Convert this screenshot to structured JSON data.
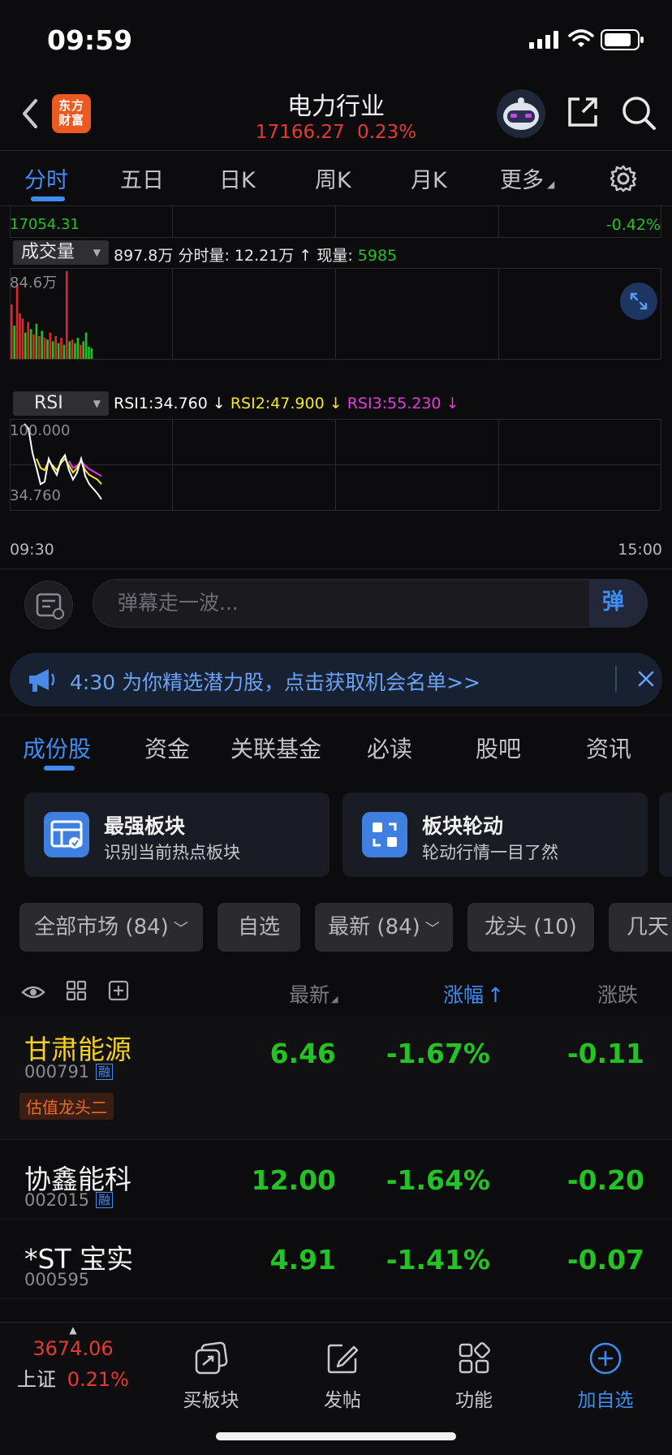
{
  "status": {
    "time": "09:59"
  },
  "header": {
    "logo_line1": "东方",
    "logo_line2": "财富",
    "title": "电力行业",
    "index_value": "17166.27",
    "index_change": "0.23%"
  },
  "chart_tabs": [
    "分时",
    "五日",
    "日K",
    "周K",
    "月K",
    "更多"
  ],
  "chart": {
    "price_low": "17054.31",
    "pct_low": "-0.42%",
    "volume": {
      "selector": "成交量",
      "total": "897.8万",
      "period_label": "分时量: 12.21万",
      "current_label": "现量:",
      "current_value": "5985",
      "max_label": "84.6万",
      "bars": [
        {
          "v": 0.62,
          "c": "red"
        },
        {
          "v": 0.38,
          "c": "green"
        },
        {
          "v": 0.85,
          "c": "red"
        },
        {
          "v": 0.52,
          "c": "red"
        },
        {
          "v": 0.46,
          "c": "red"
        },
        {
          "v": 0.3,
          "c": "green"
        },
        {
          "v": 0.42,
          "c": "red"
        },
        {
          "v": 0.34,
          "c": "green"
        },
        {
          "v": 0.28,
          "c": "red"
        },
        {
          "v": 0.4,
          "c": "green"
        },
        {
          "v": 0.26,
          "c": "red"
        },
        {
          "v": 0.32,
          "c": "green"
        },
        {
          "v": 0.24,
          "c": "red"
        },
        {
          "v": 0.22,
          "c": "green"
        },
        {
          "v": 0.3,
          "c": "red"
        },
        {
          "v": 0.2,
          "c": "green"
        },
        {
          "v": 0.26,
          "c": "red"
        },
        {
          "v": 0.18,
          "c": "green"
        },
        {
          "v": 0.24,
          "c": "red"
        },
        {
          "v": 0.16,
          "c": "green"
        },
        {
          "v": 1.0,
          "c": "red"
        },
        {
          "v": 0.2,
          "c": "green"
        },
        {
          "v": 0.22,
          "c": "red"
        },
        {
          "v": 0.18,
          "c": "green"
        },
        {
          "v": 0.24,
          "c": "green"
        },
        {
          "v": 0.16,
          "c": "red"
        },
        {
          "v": 0.2,
          "c": "green"
        },
        {
          "v": 0.3,
          "c": "green"
        },
        {
          "v": 0.14,
          "c": "green"
        },
        {
          "v": 0.12,
          "c": "green"
        }
      ]
    },
    "rsi": {
      "selector": "RSI",
      "rsi1_label": "RSI1:34.760 ↓",
      "rsi2_label": "RSI2:47.900 ↓",
      "rsi3_label": "RSI3:55.230 ↓",
      "top_label": "100.000",
      "bottom_label": "34.760",
      "rsi1_color": "#ffffff",
      "rsi2_color": "#f5e623",
      "rsi3_color": "#e43ae0",
      "rsi1": [
        100,
        96,
        75,
        62,
        48,
        50,
        70,
        62,
        56,
        68,
        73,
        60,
        52,
        58,
        70,
        55,
        48,
        44,
        40,
        35
      ],
      "rsi2": [
        null,
        null,
        null,
        70,
        62,
        60,
        68,
        64,
        60,
        66,
        70,
        64,
        58,
        62,
        68,
        60,
        56,
        54,
        52,
        48
      ],
      "rsi3": [
        null,
        null,
        null,
        null,
        null,
        null,
        null,
        null,
        null,
        null,
        null,
        68,
        62,
        64,
        68,
        64,
        61,
        59,
        57,
        55
      ]
    },
    "time_start": "09:30",
    "time_end": "15:00"
  },
  "danmaku": {
    "placeholder": "弹幕走一波...",
    "send_label": "弹"
  },
  "banner": {
    "text": "4:30 为你精选潜力股，点击获取机会名单>>"
  },
  "section_tabs": [
    "成份股",
    "资金",
    "关联基金",
    "必读",
    "股吧",
    "资讯"
  ],
  "cards": [
    {
      "title": "最强板块",
      "subtitle": "识别当前热点板块"
    },
    {
      "title": "板块轮动",
      "subtitle": "轮动行情一目了然"
    }
  ],
  "filters": [
    "全部市场 (84)",
    "自选",
    "最新 (84)",
    "龙头 (10)",
    "几天"
  ],
  "list_header": {
    "latest": "最新",
    "change_pct": "涨幅",
    "change": "涨跌"
  },
  "stocks": [
    {
      "name": "甘肃能源",
      "code": "000791",
      "tag": "融",
      "badge": "估值龙头二",
      "price": "6.46",
      "pct": "-1.67%",
      "change": "-0.11"
    },
    {
      "name": "协鑫能科",
      "code": "002015",
      "tag": "融",
      "price": "12.00",
      "pct": "-1.64%",
      "change": "-0.20"
    },
    {
      "name": "*ST 宝实",
      "code": "000595",
      "price": "4.91",
      "pct": "-1.41%",
      "change": "-0.07"
    }
  ],
  "bottom_bar": {
    "index_value": "3674.06",
    "index_name": "上证",
    "index_pct": "0.21%",
    "items": [
      "买板块",
      "发帖",
      "功能",
      "加自选"
    ]
  }
}
